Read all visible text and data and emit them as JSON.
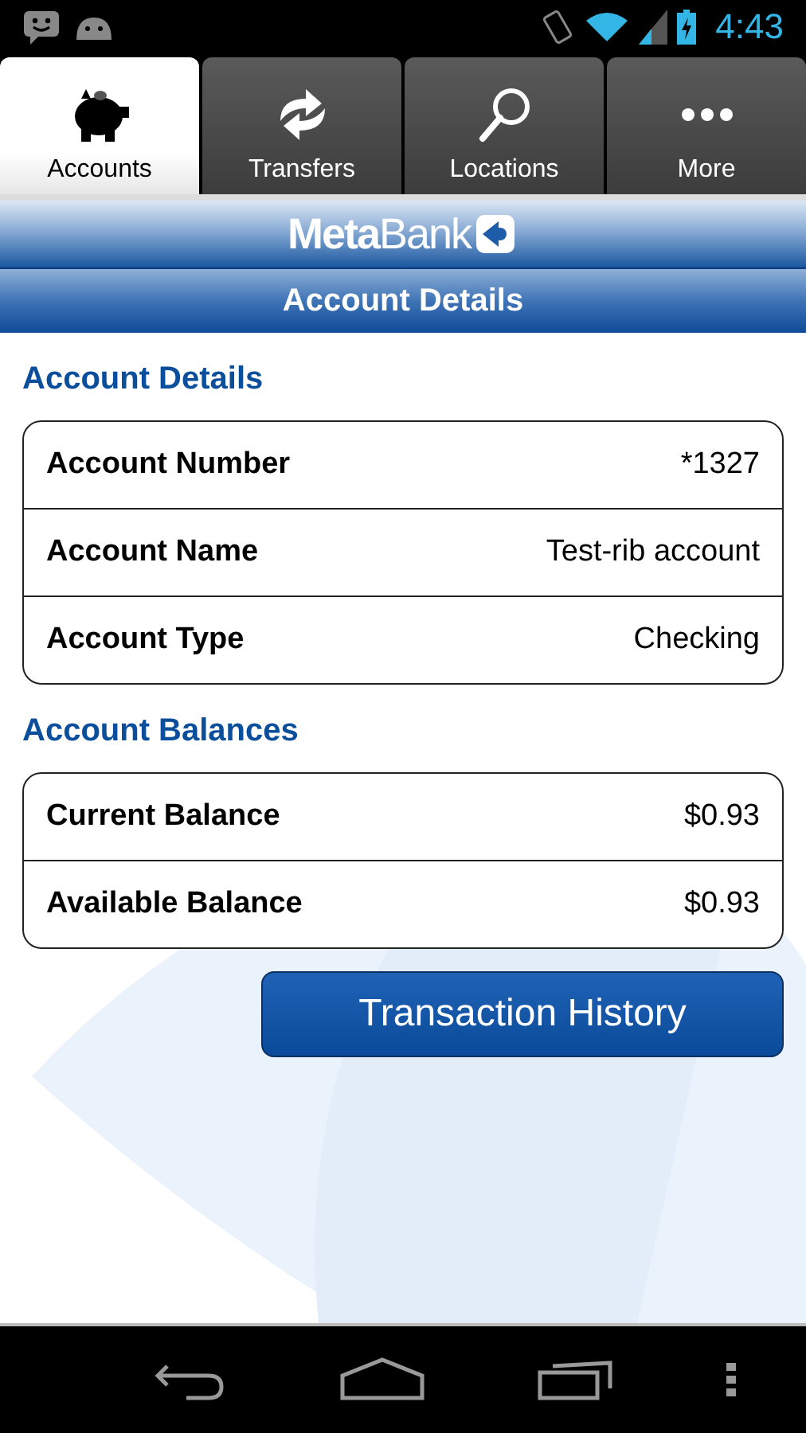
{
  "status_bar": {
    "time": "4:43"
  },
  "tabs": [
    {
      "label": "Accounts",
      "kind": "piggy",
      "selected": true
    },
    {
      "label": "Transfers",
      "kind": "arrows",
      "selected": false
    },
    {
      "label": "Locations",
      "kind": "search",
      "selected": false
    },
    {
      "label": "More",
      "kind": "dots",
      "selected": false
    }
  ],
  "logo": "**Meta**Bank",
  "title": "Account Details",
  "sections": [
    {
      "heading": "Account Details",
      "rows": [
        {
          "label": "Account Number",
          "value": "*1327"
        },
        {
          "label": "Account Name",
          "value": "Test-rib account"
        },
        {
          "label": "Account Type",
          "value": "Checking"
        }
      ]
    },
    {
      "heading": "Account Balances",
      "rows": [
        {
          "label": "Current Balance",
          "value": "$0.93"
        },
        {
          "label": "Available Balance",
          "value": "$0.93"
        }
      ]
    }
  ],
  "button": "Transaction History"
}
